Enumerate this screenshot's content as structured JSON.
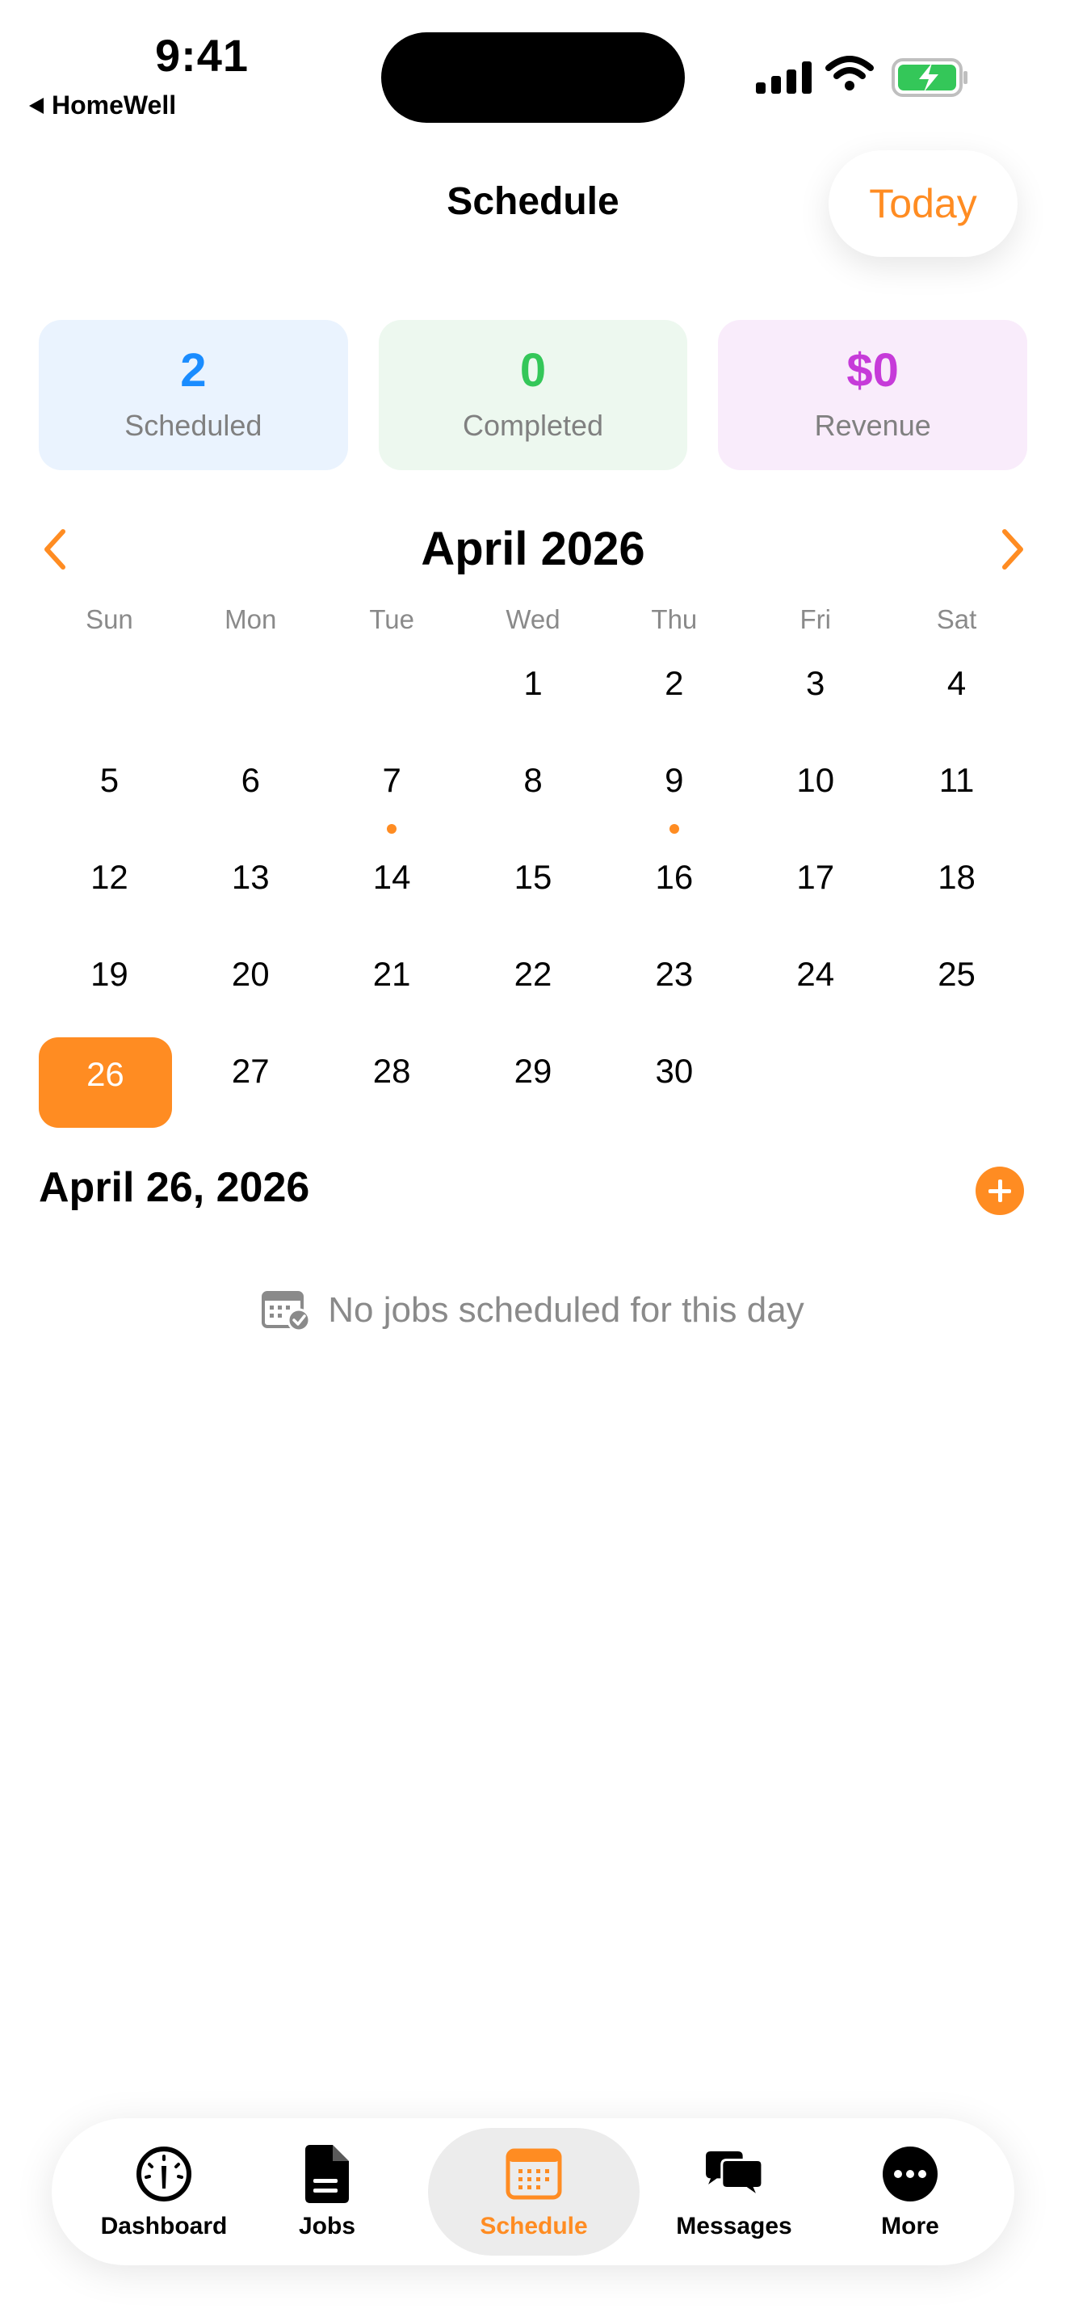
{
  "status_bar": {
    "time": "9:41",
    "back_app": "HomeWell"
  },
  "header": {
    "title": "Schedule",
    "today_label": "Today"
  },
  "stats": [
    {
      "value": "2",
      "label": "Scheduled",
      "color": "#1a8cff",
      "bg": "#eaf3fe"
    },
    {
      "value": "0",
      "label": "Completed",
      "color": "#34c759",
      "bg": "#edf8ef"
    },
    {
      "value": "$0",
      "label": "Revenue",
      "color": "#c63bd9",
      "bg": "#f9ecfb"
    }
  ],
  "calendar": {
    "month_title": "April 2026",
    "weekdays": [
      "Sun",
      "Mon",
      "Tue",
      "Wed",
      "Thu",
      "Fri",
      "Sat"
    ],
    "days": [
      "",
      "",
      "",
      "1",
      "2",
      "3",
      "4",
      "5",
      "6",
      "7",
      "8",
      "9",
      "10",
      "11",
      "12",
      "13",
      "14",
      "15",
      "16",
      "17",
      "18",
      "19",
      "20",
      "21",
      "22",
      "23",
      "24",
      "25",
      "26",
      "27",
      "28",
      "29",
      "30"
    ],
    "selected_day": "26",
    "days_with_jobs": [
      "7",
      "9"
    ]
  },
  "selected_date": {
    "heading": "April 26, 2026",
    "empty_message": "No jobs scheduled for this day"
  },
  "tab_bar": {
    "items": [
      {
        "label": "Dashboard",
        "icon": "gauge-icon"
      },
      {
        "label": "Jobs",
        "icon": "document-icon"
      },
      {
        "label": "Schedule",
        "icon": "calendar-icon",
        "active": true
      },
      {
        "label": "Messages",
        "icon": "chat-bubbles-icon"
      },
      {
        "label": "More",
        "icon": "more-icon"
      }
    ]
  },
  "colors": {
    "accent": "#ff8c22"
  }
}
